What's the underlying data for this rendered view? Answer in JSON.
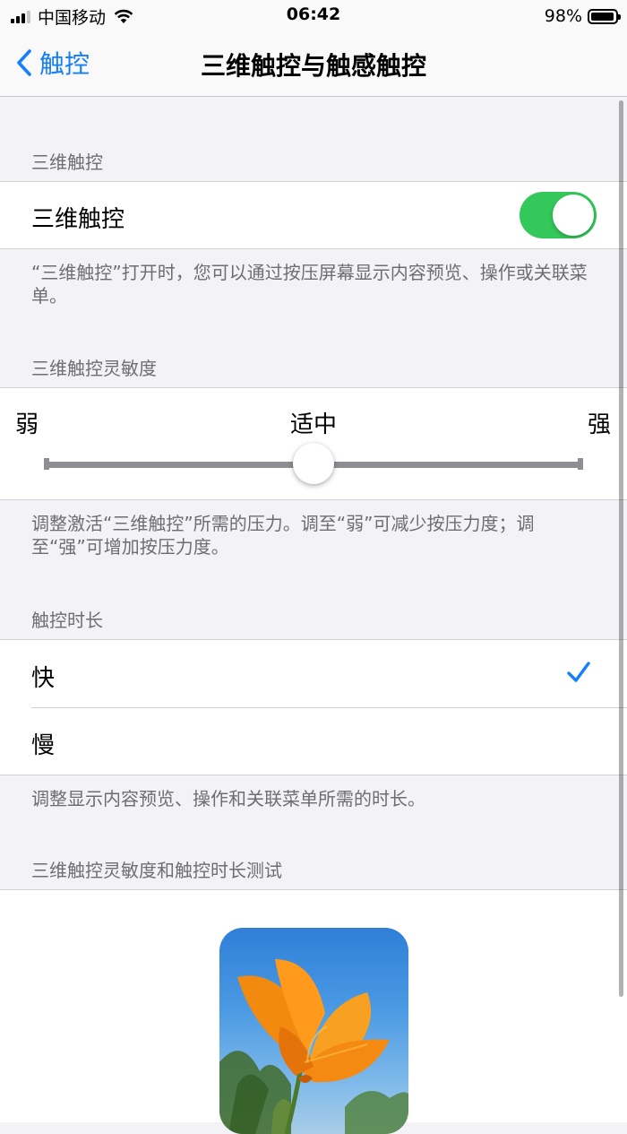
{
  "status_bar": {
    "carrier": "中国移动",
    "time": "06:42",
    "battery": "98%",
    "battery_level": 0.98
  },
  "nav": {
    "back_label": "触控",
    "title": "三维触控与触感触控"
  },
  "touch3d": {
    "header": "三维触控",
    "label": "三维触控",
    "enabled": true,
    "footer": "“三维触控”打开时，您可以通过按压屏幕显示内容预览、操作或关联菜单。"
  },
  "sensitivity": {
    "header": "三维触控灵敏度",
    "light_label": "弱",
    "current_label": "适中",
    "firm_label": "强",
    "value": 0.5,
    "footer": "调整激活“三维触控”所需的压力。调至“弱”可减少按压力度；调至“强”可增加按压力度。"
  },
  "duration": {
    "header": "触控时长",
    "options": [
      {
        "label": "快",
        "selected": true
      },
      {
        "label": "慢",
        "selected": false
      }
    ],
    "footer": "调整显示内容预览、操作和关联菜单所需的时长。"
  },
  "test": {
    "header": "三维触控灵敏度和触控时长测试"
  },
  "colors": {
    "accent": "#147efb",
    "toggle_on": "#34c759",
    "background": "#f2f2f7",
    "secondary_text": "#6d6d72"
  }
}
